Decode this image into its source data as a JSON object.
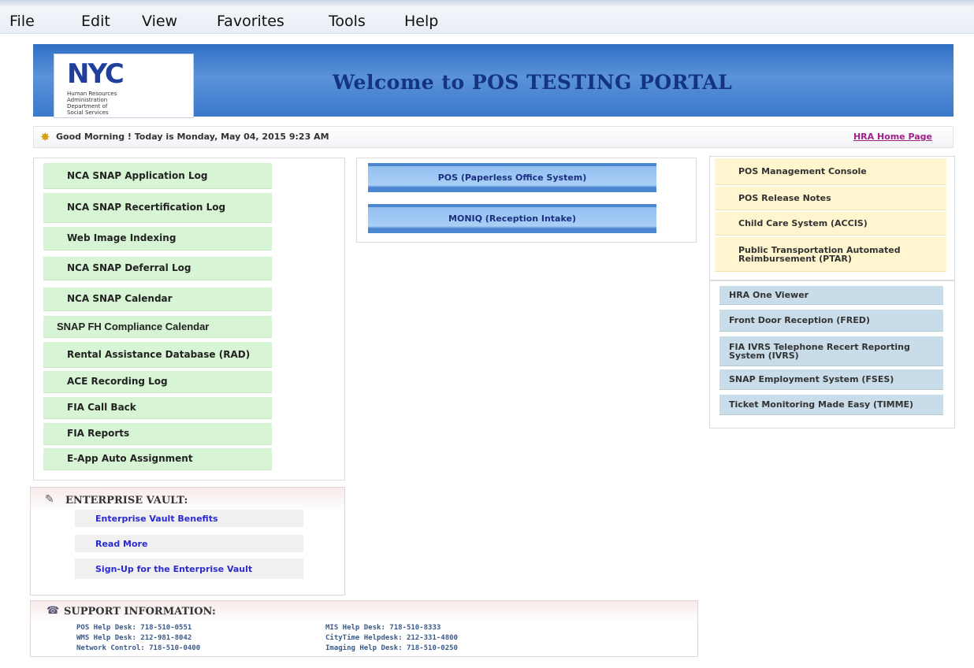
{
  "menubar": {
    "items": [
      "File",
      "Edit",
      "View",
      "Favorites",
      "Tools",
      "Help"
    ]
  },
  "banner": {
    "logo": {
      "mark": "NYC",
      "lines": [
        "Human Resources",
        "Administration",
        "Department of",
        "Social Services"
      ]
    },
    "title": "Welcome to POS TESTING PORTAL"
  },
  "greeting": {
    "text": "Good Morning !   Today is Monday, May 04, 2015 9:23 AM",
    "home_link": "HRA Home Page"
  },
  "left_menu": {
    "items": [
      "NCA SNAP Application Log",
      "NCA SNAP Recertification Log",
      "Web Image Indexing",
      "NCA SNAP Deferral Log",
      "NCA SNAP Calendar",
      "SNAP FH Compliance Calendar",
      "Rental Assistance Database (RAD)",
      "ACE Recording Log",
      "FIA Call Back",
      "FIA Reports",
      "E-App Auto Assignment"
    ]
  },
  "center_menu": {
    "items": [
      "POS (Paperless Office System)",
      "MONIQ (Reception Intake)"
    ]
  },
  "right_menu": {
    "yellow_items": [
      "POS Management Console",
      "POS Release Notes",
      "Child Care System (ACCIS)",
      "Public Transportation Automated Reimbursement (PTAR)"
    ],
    "blue_items": [
      "HRA One Viewer",
      "Front Door Reception (FRED)",
      "FIA IVRS Telephone Recert Reporting System (IVRS)",
      "SNAP Employment System (FSES)",
      "Ticket Monitoring Made Easy (TIMME)"
    ]
  },
  "enterprise_vault": {
    "heading": "ENTERPRISE VAULT:",
    "items": [
      "Enterprise Vault Benefits",
      "Read More",
      "Sign-Up for the Enterprise Vault"
    ]
  },
  "support": {
    "heading": "SUPPORT INFORMATION:",
    "left": [
      "POS Help Desk: 718-510-0551",
      "WMS Help Desk: 212-981-8042",
      "Network Control: 718-510-0400"
    ],
    "right": [
      "MIS Help Desk: 718-510-8333",
      "CityTime Helpdesk: 212-331-4800",
      "Imaging Help Desk: 718-510-0250"
    ]
  }
}
